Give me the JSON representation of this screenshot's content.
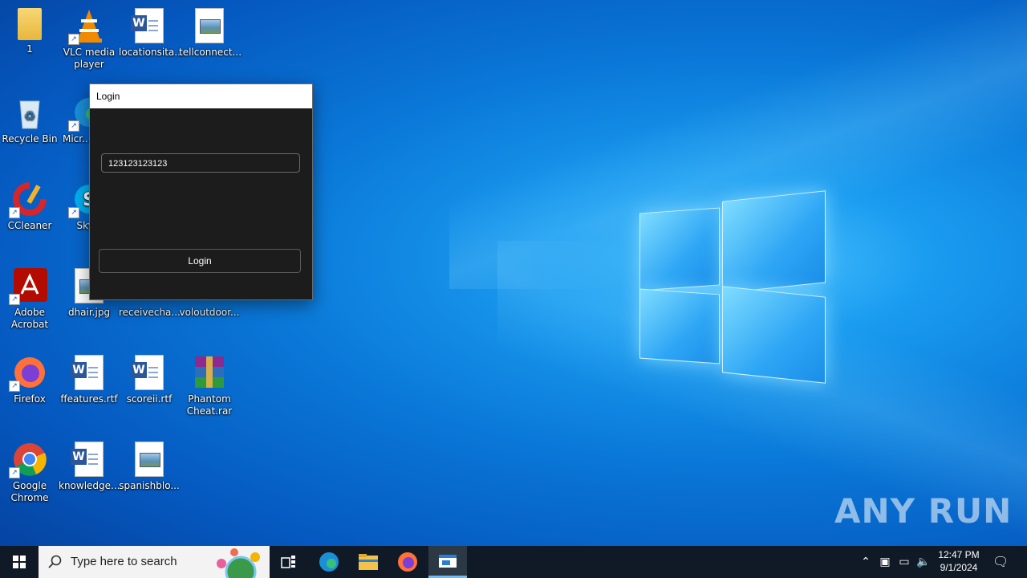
{
  "desktop": {
    "icons": [
      {
        "label": "1"
      },
      {
        "label": "VLC media player"
      },
      {
        "label": "locationsita..."
      },
      {
        "label": "tellconnect..."
      },
      {
        "label": "Recycle Bin"
      },
      {
        "label": "Micr... Ed..."
      },
      {
        "label": "CCleaner"
      },
      {
        "label": "Sky..."
      },
      {
        "label": "Adobe Acrobat"
      },
      {
        "label": "dhair.jpg"
      },
      {
        "label": "receivecha..."
      },
      {
        "label": "voloutdoor..."
      },
      {
        "label": "Firefox"
      },
      {
        "label": "ffeatures.rtf"
      },
      {
        "label": "scoreii.rtf"
      },
      {
        "label": "Phantom Cheat.rar"
      },
      {
        "label": "Google Chrome"
      },
      {
        "label": "knowledge..."
      },
      {
        "label": "spanishblo..."
      }
    ]
  },
  "login_window": {
    "title": "Login",
    "username_value": "123123123123",
    "button_label": "Login"
  },
  "watermark": "ANY RUN",
  "taskbar": {
    "search_placeholder": "Type here to search",
    "clock_time": "12:47 PM",
    "clock_date": "9/1/2024",
    "apps": [
      "task-view",
      "edge",
      "file-explorer",
      "firefox",
      "login-app"
    ]
  },
  "colors": {
    "wallpaper": "#0a78d8",
    "taskbar": "#101a26",
    "window_bg": "#1c1c1c",
    "accent": "#76b9ed"
  }
}
